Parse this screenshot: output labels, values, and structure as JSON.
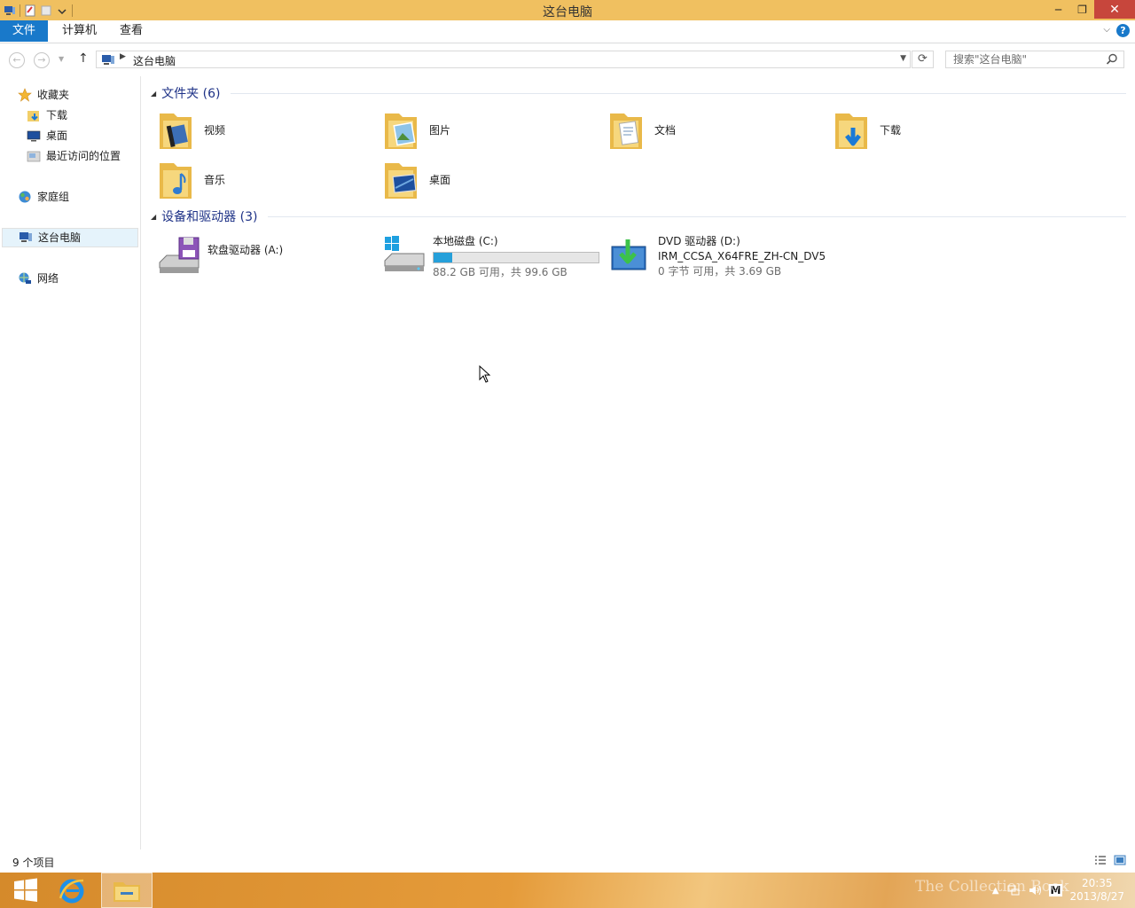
{
  "window": {
    "title": "这台电脑"
  },
  "window_controls": {
    "minimize": "─",
    "restore": "❐",
    "close": "✕"
  },
  "ribbon": {
    "tabs": [
      "文件",
      "计算机",
      "查看"
    ],
    "help": "?"
  },
  "address": {
    "crumb": "这台电脑"
  },
  "search": {
    "placeholder": "搜索\"这台电脑\""
  },
  "sidebar": {
    "favorites": {
      "label": "收藏夹",
      "icon": "star-icon"
    },
    "favorite_items": [
      {
        "label": "下载",
        "icon": "downloads-folder-icon"
      },
      {
        "label": "桌面",
        "icon": "desktop-icon"
      },
      {
        "label": "最近访问的位置",
        "icon": "recent-places-icon"
      }
    ],
    "homegroup": {
      "label": "家庭组",
      "icon": "homegroup-icon"
    },
    "this_pc": {
      "label": "这台电脑",
      "icon": "computer-icon"
    },
    "network": {
      "label": "网络",
      "icon": "network-icon"
    }
  },
  "content": {
    "folders_header": "文件夹 (6)",
    "folders": [
      {
        "label": "视频",
        "icon": "videos-folder-icon"
      },
      {
        "label": "图片",
        "icon": "pictures-folder-icon"
      },
      {
        "label": "文档",
        "icon": "documents-folder-icon"
      },
      {
        "label": "下载",
        "icon": "downloads-folder-icon"
      },
      {
        "label": "音乐",
        "icon": "music-folder-icon"
      },
      {
        "label": "桌面",
        "icon": "desktop-folder-icon"
      }
    ],
    "devices_header": "设备和驱动器 (3)",
    "drives": [
      {
        "name": "软盘驱动器 (A:)",
        "icon": "floppy-drive-icon"
      },
      {
        "name": "本地磁盘 (C:)",
        "icon": "local-disk-icon",
        "used_fraction": 0.114,
        "space": "88.2 GB 可用，共 99.6 GB"
      },
      {
        "name": "DVD 驱动器 (D:)",
        "icon": "dvd-drive-icon",
        "volume": "IRM_CCSA_X64FRE_ZH-CN_DV5",
        "space": "0 字节 可用，共 3.69 GB"
      }
    ]
  },
  "status": {
    "count": "9 个项目"
  },
  "taskbar": {
    "time": "20:35",
    "date": "2013/8/27",
    "ime": "M"
  },
  "watermark": "The Collection Book",
  "colors": {
    "accent": "#1979ca",
    "titlebar": "#f0c060",
    "group_header": "#1e3287",
    "usage_bar": "#26a0da"
  }
}
